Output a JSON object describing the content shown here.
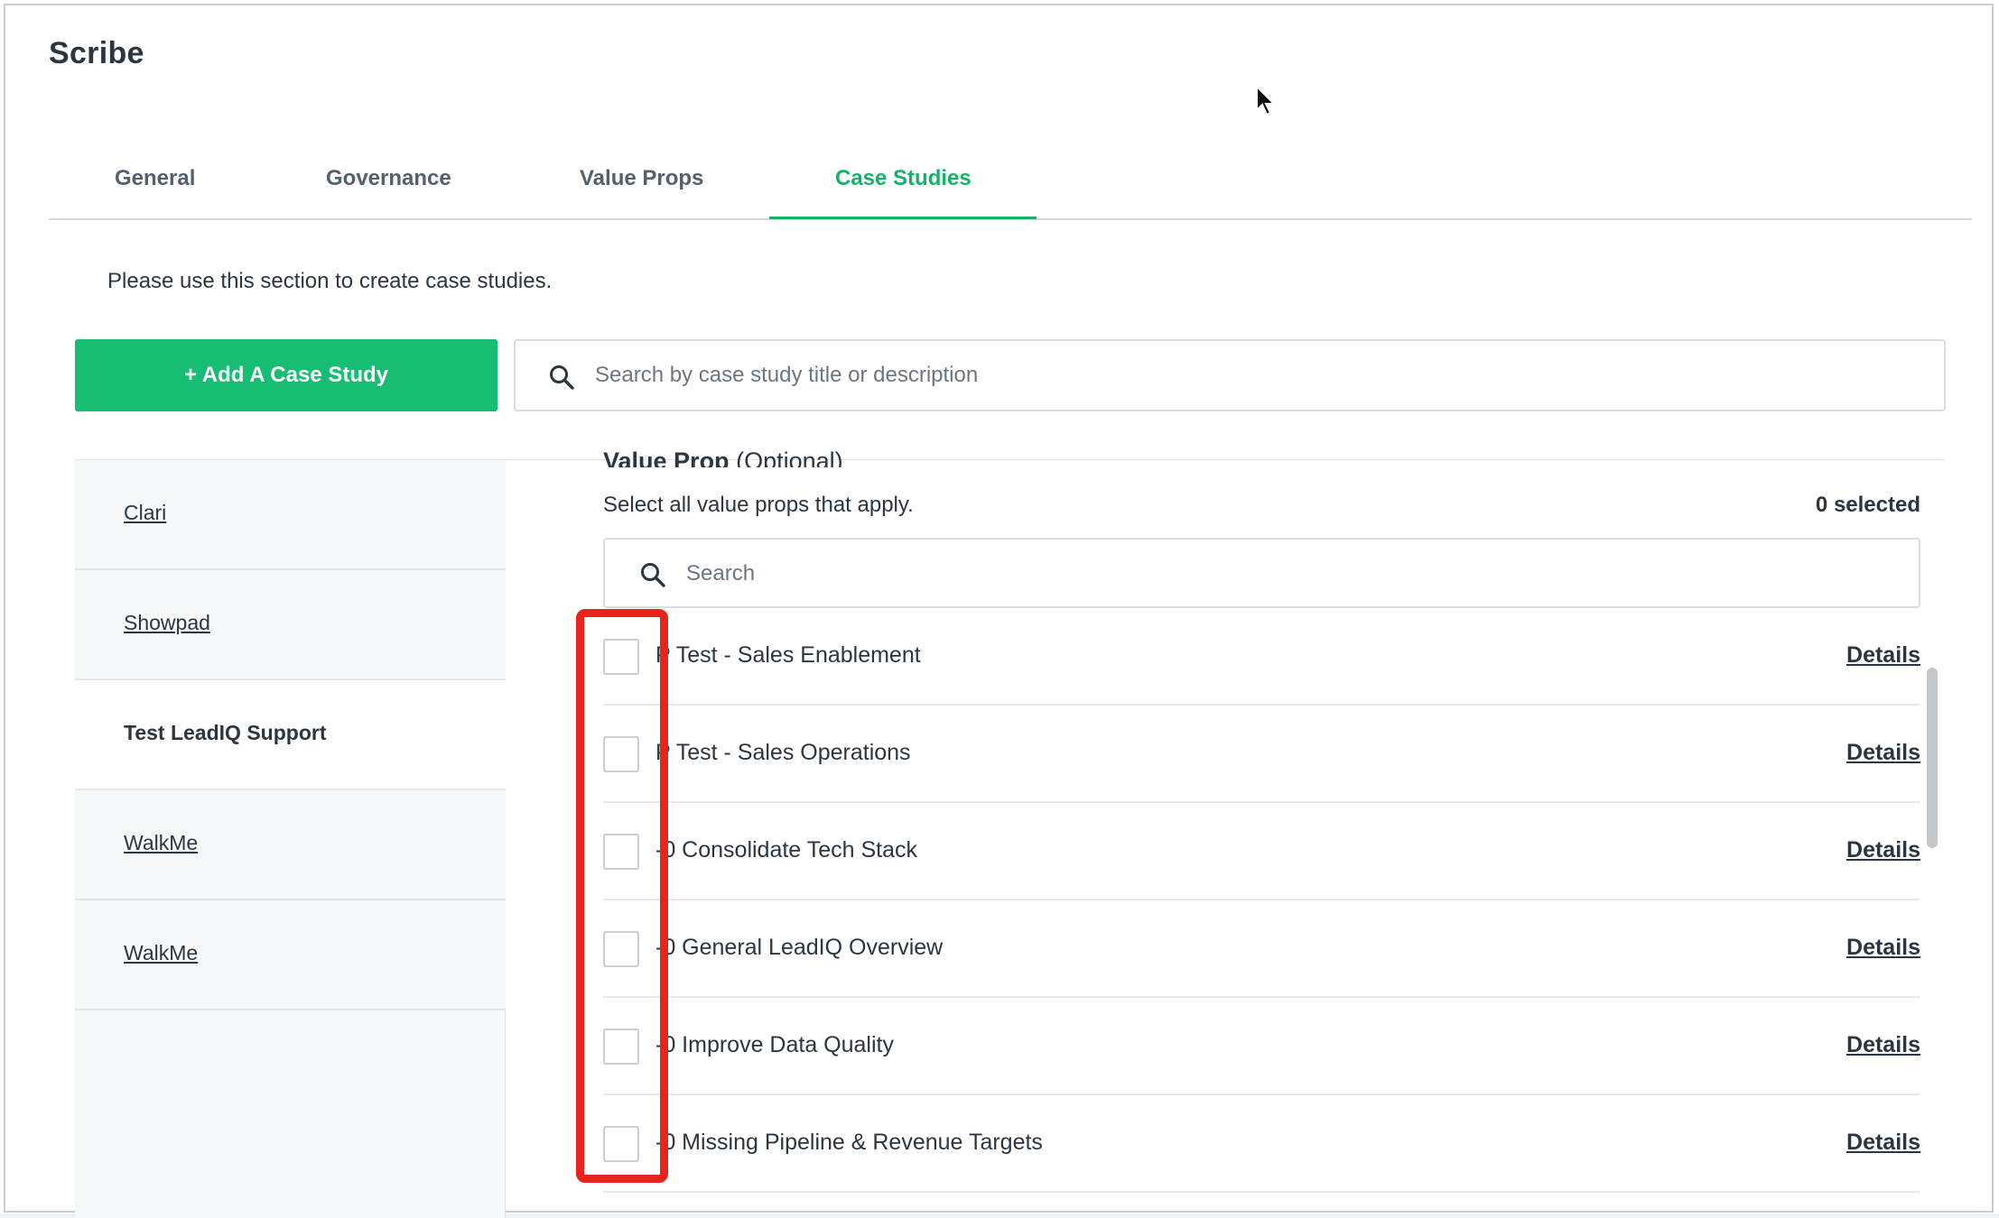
{
  "app": {
    "title": "Scribe"
  },
  "tabs": [
    {
      "label": "General",
      "active": false
    },
    {
      "label": "Governance",
      "active": false
    },
    {
      "label": "Value Props",
      "active": false
    },
    {
      "label": "Case Studies",
      "active": true
    }
  ],
  "intro_text": "Please use this section to create case studies.",
  "add_button_label": "+ Add A Case Study",
  "case_search": {
    "placeholder": "Search by case study title or description",
    "icon": "search-icon"
  },
  "sidebar": {
    "items": [
      {
        "label": "Clari",
        "selected": false
      },
      {
        "label": "Showpad",
        "selected": false
      },
      {
        "label": "Test LeadIQ Support",
        "selected": true
      },
      {
        "label": "WalkMe",
        "selected": false
      },
      {
        "label": "WalkMe",
        "selected": false
      }
    ]
  },
  "value_prop": {
    "title": "Value Prop",
    "title_suffix": "(Optional)",
    "subtitle": "Select all value props that apply.",
    "selected_count": "0 selected",
    "search_placeholder": "Search",
    "details_label": "Details",
    "items": [
      {
        "name": "P Test - Sales Enablement",
        "checked": false
      },
      {
        "name": "P Test - Sales Operations",
        "checked": false
      },
      {
        "name": "-0 Consolidate Tech Stack",
        "checked": false
      },
      {
        "name": "-0 General LeadIQ Overview",
        "checked": false
      },
      {
        "name": "-0 Improve Data Quality",
        "checked": false
      },
      {
        "name": "-0 Missing Pipeline & Revenue Targets",
        "checked": false
      }
    ]
  },
  "colors": {
    "accent": "#17b26a",
    "button": "#17bd72",
    "highlight": "#e8241c"
  }
}
